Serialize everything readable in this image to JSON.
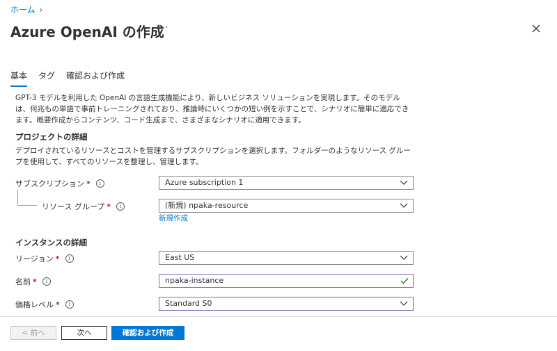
{
  "breadcrumb": {
    "home": "ホーム"
  },
  "header": {
    "title": "Azure OpenAI の作成",
    "more": "···"
  },
  "tabs": [
    {
      "label": "基本"
    },
    {
      "label": "タグ"
    },
    {
      "label": "確認および作成"
    }
  ],
  "intro": "GPT-3 モデルを利用した OpenAI の言語生成機能により、新しいビジネス ソリューションを実現します。そのモデルは、何兆もの単語で事前トレーニングされており、推論時にいくつかの短い例を示すことで、シナリオに簡単に適応できます。概要作成からコンテンツ、コード生成まで、さまざまなシナリオに適用できます。",
  "project": {
    "heading": "プロジェクトの詳細",
    "description": "デプロイされているリソースとコストを管理するサブスクリプションを選択します。フォルダーのようなリソース グループを使用して、すべてのリソースを整理し、管理します。",
    "subscription": {
      "label": "サブスクリプション",
      "value": "Azure subscription 1"
    },
    "resource_group": {
      "label": "リソース グループ",
      "value": "(新規) npaka-resource",
      "new_link": "新規作成"
    }
  },
  "instance": {
    "heading": "インスタンスの詳細",
    "region": {
      "label": "リージョン",
      "value": "East US"
    },
    "name": {
      "label": "名前",
      "value": "npaka-instance"
    },
    "pricing": {
      "label": "価格レベル",
      "value": "Standard S0"
    }
  },
  "required_mark": "*",
  "info_glyph": "i",
  "footer": {
    "prev": "< 前へ",
    "next": "次へ",
    "create": "確認および作成"
  },
  "colors": {
    "accent": "#0078d4",
    "required": "#a4262c",
    "valid": "#107c10",
    "focus": "#8764b8"
  }
}
